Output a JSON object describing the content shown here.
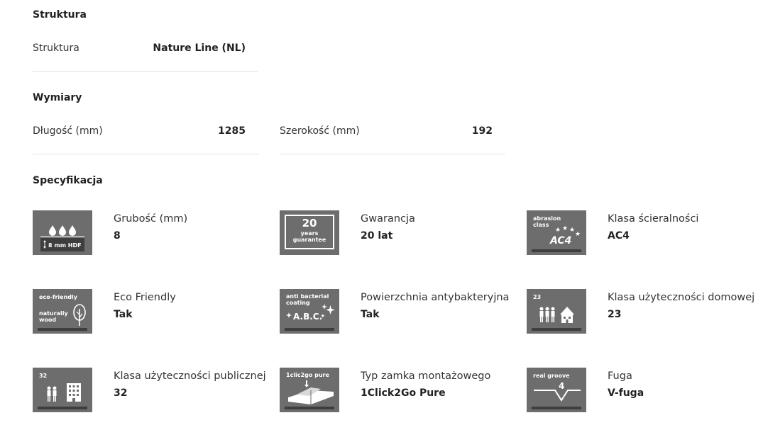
{
  "struktura": {
    "title": "Struktura",
    "rows": [
      {
        "label": "Struktura",
        "value": "Nature Line (NL)"
      }
    ]
  },
  "wymiary": {
    "title": "Wymiary",
    "rows": [
      {
        "label": "Długość (mm)",
        "value": "1285"
      },
      {
        "label": "Szerokość (mm)",
        "value": "192"
      }
    ]
  },
  "specyfikacja": {
    "title": "Specyfikacja",
    "items": [
      {
        "label": "Grubość (mm)",
        "value": "8",
        "icon": "water-drops-icon",
        "icon_text": "8 mm HDF"
      },
      {
        "label": "Gwarancja",
        "value": "20 lat",
        "icon": "guarantee-icon",
        "icon_text_big": "20",
        "icon_text_small": "years guarantee"
      },
      {
        "label": "Klasa ścieralności",
        "value": "AC4",
        "icon": "abrasion-class-icon",
        "icon_text_small": "abrasion class",
        "icon_text_big": "AC4"
      },
      {
        "label": "Eco Friendly",
        "value": "Tak",
        "icon": "eco-friendly-icon",
        "icon_text_top": "eco-friendly",
        "icon_text_bottom": "naturally wood"
      },
      {
        "label": "Powierzchnia antybakteryjna",
        "value": "Tak",
        "icon": "antibacterial-icon",
        "icon_text_top": "anti bacterial coating",
        "icon_text_big": "A.B.C."
      },
      {
        "label": "Klasa użyteczności domowej",
        "value": "23",
        "icon": "domestic-use-icon",
        "icon_text_top": "23"
      },
      {
        "label": "Klasa użyteczności publicznej",
        "value": "32",
        "icon": "public-use-icon",
        "icon_text_top": "32"
      },
      {
        "label": "Typ zamka montażowego",
        "value": "1Click2Go Pure",
        "icon": "click-lock-icon",
        "icon_text_top": "1clic2go pure"
      },
      {
        "label": "Fuga",
        "value": "V-fuga",
        "icon": "real-groove-icon",
        "icon_text_top": "real groove",
        "icon_text_big": "4"
      }
    ]
  },
  "colors": {
    "icon_bg": "#6d6d6d",
    "divider": "#e3e3e3"
  }
}
